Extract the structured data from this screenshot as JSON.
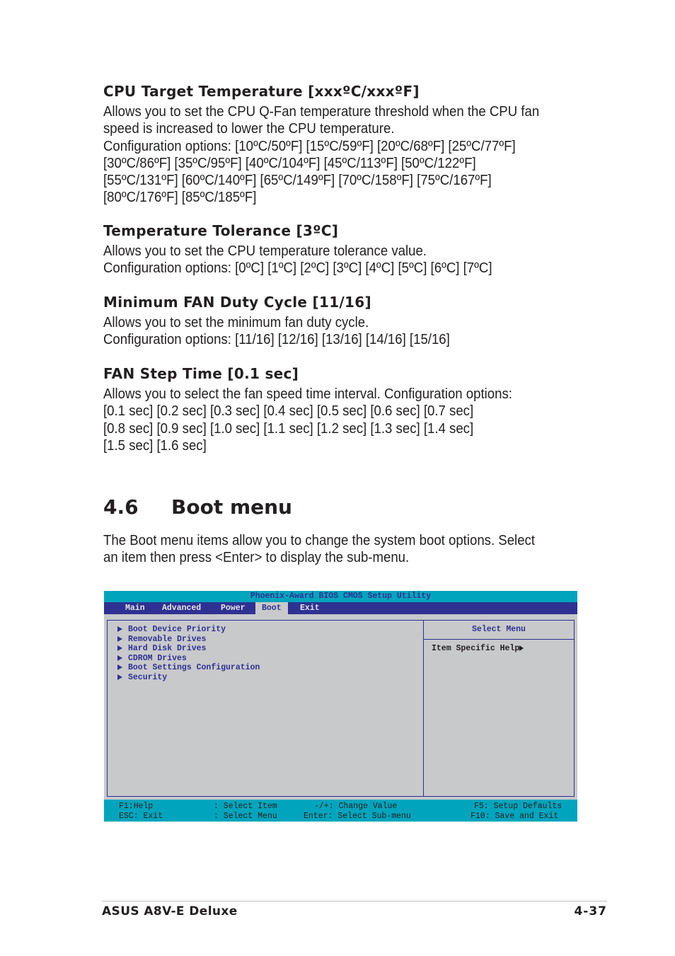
{
  "sections": {
    "cpu_target": {
      "heading": "CPU Target Temperature [xxxºC/xxxºF]",
      "lines": [
        "Allows you to set the CPU Q-Fan temperature threshold when the CPU fan",
        "speed is increased to lower the CPU temperature.",
        "Configuration options: [10ºC/50ºF] [15ºC/59ºF] [20ºC/68ºF] [25ºC/77ºF]",
        "[30ºC/86ºF] [35ºC/95ºF] [40ºC/104ºF] [45ºC/113ºF] [50ºC/122ºF]",
        "[55ºC/131ºF] [60ºC/140ºF] [65ºC/149ºF] [70ºC/158ºF] [75ºC/167ºF]",
        "[80ºC/176ºF] [85ºC/185ºF]"
      ]
    },
    "temp_tolerance": {
      "heading": "Temperature Tolerance [3ºC]",
      "lines": [
        "Allows you to set the CPU temperature tolerance value.",
        "Configuration options: [0ºC] [1ºC] [2ºC] [3ºC] [4ºC] [5ºC] [6ºC] [7ºC]"
      ]
    },
    "min_fan_duty": {
      "heading": "Minimum FAN Duty Cycle [11/16]",
      "lines": [
        "Allows you to set the minimum fan duty cycle.",
        "Configuration options: [11/16] [12/16] [13/16]  [14/16] [15/16]"
      ]
    },
    "fan_step_time": {
      "heading": "FAN Step Time [0.1 sec]",
      "lines": [
        "Allows you to select the fan speed time interval. Configuration options:",
        "[0.1 sec] [0.2 sec] [0.3 sec] [0.4 sec] [0.5 sec] [0.6 sec] [0.7 sec]",
        "[0.8 sec] [0.9 sec] [1.0 sec] [1.1 sec] [1.2 sec] [1.3 sec] [1.4 sec]",
        "[1.5 sec] [1.6 sec]"
      ]
    }
  },
  "chapter": {
    "number": "4.6",
    "title": "Boot menu",
    "intro_lines": [
      "The Boot menu items allow you to change the system boot options. Select",
      "an item then press <Enter> to display the sub-menu."
    ]
  },
  "bios": {
    "title": "Phoenix-Award BIOS CMOS Setup Utility",
    "tabs": [
      "Main",
      "Advanced",
      "Power",
      "Boot",
      "Exit"
    ],
    "active_tab": "Boot",
    "items": [
      "Boot Device Priority",
      "Removable Drives",
      "Hard Disk Drives",
      "CDROM Drives",
      "Boot Settings Configuration",
      "Security"
    ],
    "help_header": "Select Menu",
    "help_text": "Item Specific Help",
    "footer": {
      "f1": "F1:Help",
      "esc": "ESC: Exit",
      "select_item": ": Select Item",
      "select_menu": ": Select Menu",
      "change_value": "-/+: Change Value",
      "enter": "Enter: Select Sub-menu",
      "f5": "F5: Setup Defaults",
      "f10": "F10: Save and Exit"
    },
    "colors": {
      "title_bar": "#00a5bd",
      "menu_bar": "#2e3192",
      "panel": "#c8c9cb",
      "text": "#2e3192"
    }
  },
  "footer": {
    "product": "ASUS A8V-E Deluxe",
    "page": "4-37"
  }
}
